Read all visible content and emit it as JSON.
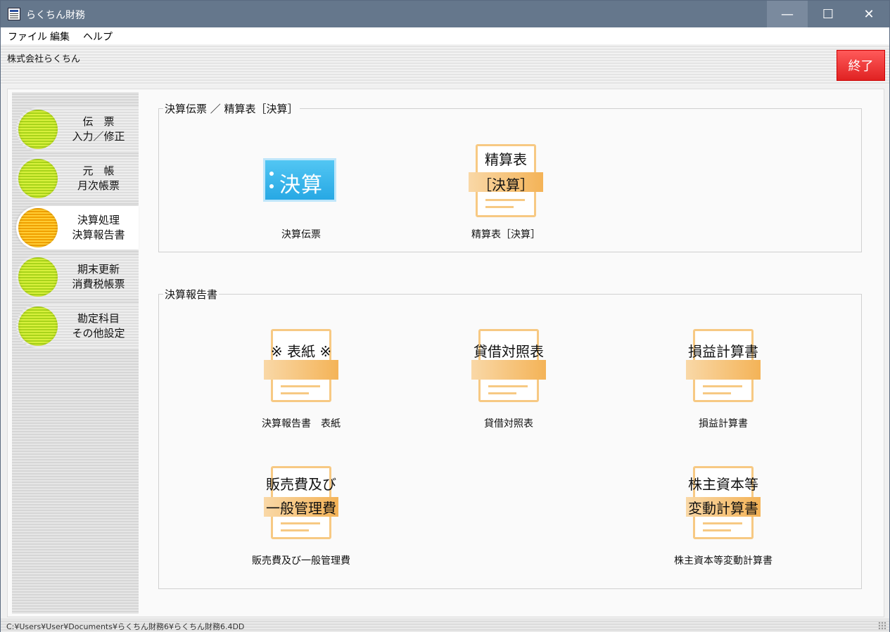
{
  "window": {
    "title": "らくちん財務",
    "min_glyph": "—",
    "max_glyph": "☐",
    "close_glyph": "✕"
  },
  "menu": [
    "ファイル",
    "編集",
    "ヘルプ"
  ],
  "header": {
    "company": "株式会社らくちん",
    "exit_label": "終了"
  },
  "sidebar": {
    "items": [
      {
        "line1": "伝　票",
        "line2": "入力／修正",
        "active": false
      },
      {
        "line1": "元　帳",
        "line2": "月次帳票",
        "active": false
      },
      {
        "line1": "決算処理",
        "line2": "決算報告書",
        "active": true
      },
      {
        "line1": "期末更新",
        "line2": "消費税帳票",
        "active": false
      },
      {
        "line1": "勘定科目",
        "line2": "その他設定",
        "active": false
      }
    ]
  },
  "group1": {
    "title": "決算伝票 ／ 精算表［決算］",
    "tiles": [
      {
        "caption": "決算伝票",
        "icon_text": "決算",
        "icon": "kessan-slip-icon"
      },
      {
        "caption": "精算表［決算］",
        "icon_top": "精算表",
        "icon_band": "［決算］",
        "icon": "worksheet-icon"
      }
    ]
  },
  "group2": {
    "title": "決算報告書",
    "tiles": [
      {
        "caption": "決算報告書　表紙",
        "icon_top": "※ 表紙 ※",
        "icon_band": "",
        "icon": "cover-icon"
      },
      {
        "caption": "貸借対照表",
        "icon_top": "貸借対照表",
        "icon_band": "",
        "icon": "balance-sheet-icon"
      },
      {
        "caption": "損益計算書",
        "icon_top": "損益計算書",
        "icon_band": "",
        "icon": "income-statement-icon"
      },
      {
        "caption": "販売費及び一般管理費",
        "icon_top": "販売費及び",
        "icon_band": "一般管理費",
        "icon": "sga-icon"
      },
      {
        "caption": "株主資本等変動計算書",
        "icon_top": "株主資本等",
        "icon_band": "変動計算書",
        "icon": "equity-statement-icon"
      }
    ]
  },
  "status": {
    "path": "C:¥Users¥User¥Documents¥らくちん財務6¥らくちん財務6.4DD"
  },
  "colors": {
    "titlebar": "#65778c",
    "exit": "#e02222",
    "ball_green": "#a9d41a",
    "ball_orange": "#f0a000",
    "doc_orange": "#f4b357",
    "kessan_blue": "#27a8e4"
  }
}
